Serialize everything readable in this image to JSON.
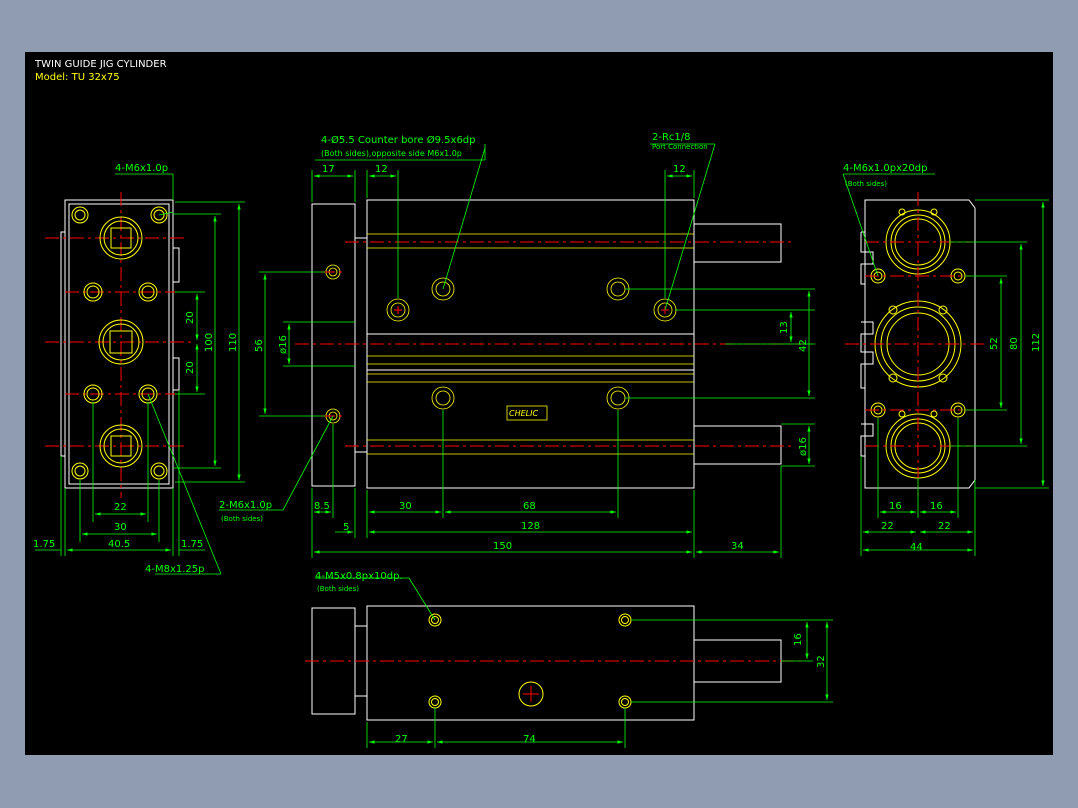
{
  "drawing": {
    "title": "TWIN GUIDE JIG CYLINDER",
    "model_label": "Model:",
    "model_value": "TU 32x75"
  },
  "colors": {
    "background": "#000000",
    "outline": "#ffffff",
    "dimension": "#00ff00",
    "centerline": "#ff0000",
    "feature": "#ffff00",
    "frame": "#8f9cb1"
  },
  "annotations": {
    "left_top_thread": "4-M6x1.0p",
    "left_bottom_thread": "4-M8x1.25p",
    "front_side_thread": "2-M6x1.0p",
    "front_side_thread_note": "(Both sides)",
    "counterbore_line1": "4-Ø5.5  Counter bore Ø9.5x6dp",
    "counterbore_line2": "(Both sides),opposite side M6x1.0p",
    "port": "2-Rc1/8",
    "port_note": "Port Connection",
    "right_thread": "4-M6x1.0px20dp",
    "right_thread_note": "(Both sides)",
    "bottom_thread": "4-M5x0.8px10dp.",
    "bottom_thread_note": "(Both sides)",
    "nameplate": "CHELIC"
  },
  "dims": {
    "left": {
      "d20a": "20",
      "d20b": "20",
      "d100": "100",
      "d110": "110",
      "d22": "22",
      "d30": "30",
      "d40_5": "40.5",
      "d1_75a": "1.75",
      "d1_75b": "1.75"
    },
    "front": {
      "d17": "17",
      "d12a": "12",
      "d12b": "12",
      "d56": "56",
      "dphi16a": "ø16",
      "d13": "13",
      "d42": "42",
      "dphi16b": "ø16",
      "d8_5": "8.5",
      "d5": "5",
      "d30": "30",
      "d68": "68",
      "d128": "128",
      "d150": "150",
      "d34": "34"
    },
    "right": {
      "d52": "52",
      "d80": "80",
      "d112": "112",
      "d16a": "16",
      "d16b": "16",
      "d22a": "22",
      "d22b": "22",
      "d44": "44"
    },
    "bottom": {
      "d16": "16",
      "d32": "32",
      "d27": "27",
      "d74": "74"
    }
  }
}
